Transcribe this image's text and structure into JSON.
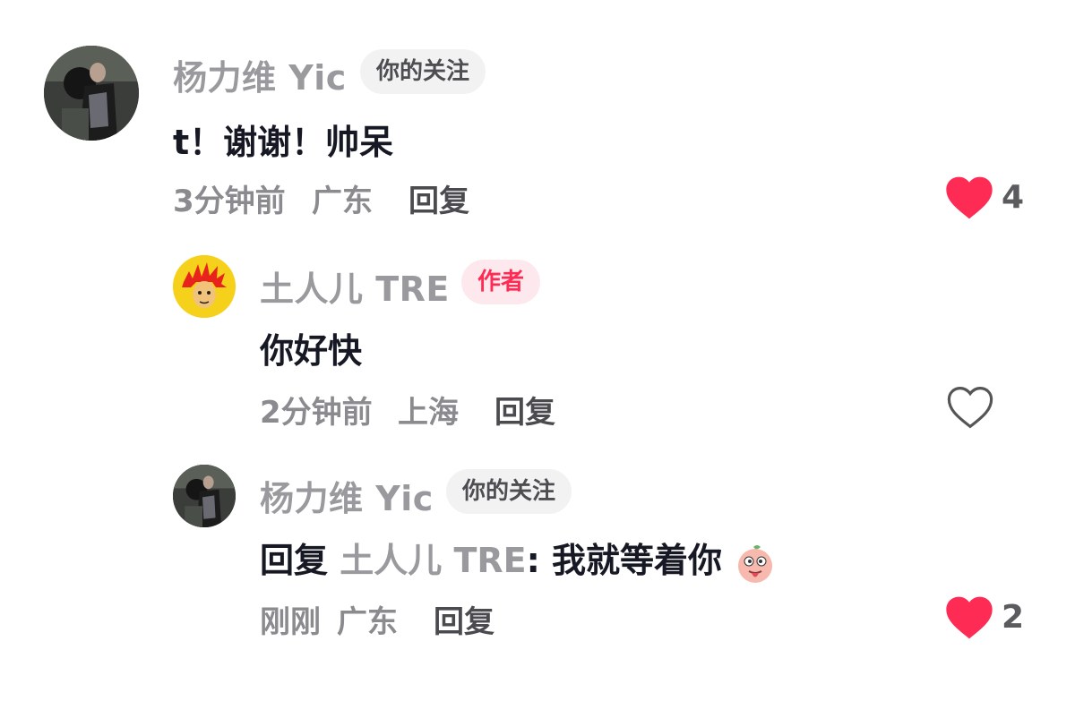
{
  "comments": [
    {
      "username": "杨力维 Yic",
      "badge": "你的关注",
      "text": "t！谢谢！帅呆",
      "time": "3分钟前",
      "location": "广东",
      "reply_label": "回复",
      "likes": "4",
      "liked": true
    },
    {
      "username": "土人儿 TRE",
      "badge": "作者",
      "text": "你好快",
      "time": "2分钟前",
      "location": "上海",
      "reply_label": "回复",
      "likes": "",
      "liked": false
    },
    {
      "username": "杨力维 Yic",
      "badge": "你的关注",
      "reply_prefix": "回复",
      "reply_target": "土人儿 TRE",
      "text": ": 我就等着你",
      "time": "刚刚",
      "location": "广东",
      "reply_label": "回复",
      "likes": "2",
      "liked": true
    }
  ],
  "colors": {
    "like_active": "#fe2c55",
    "author_badge": "#fe2c55"
  }
}
